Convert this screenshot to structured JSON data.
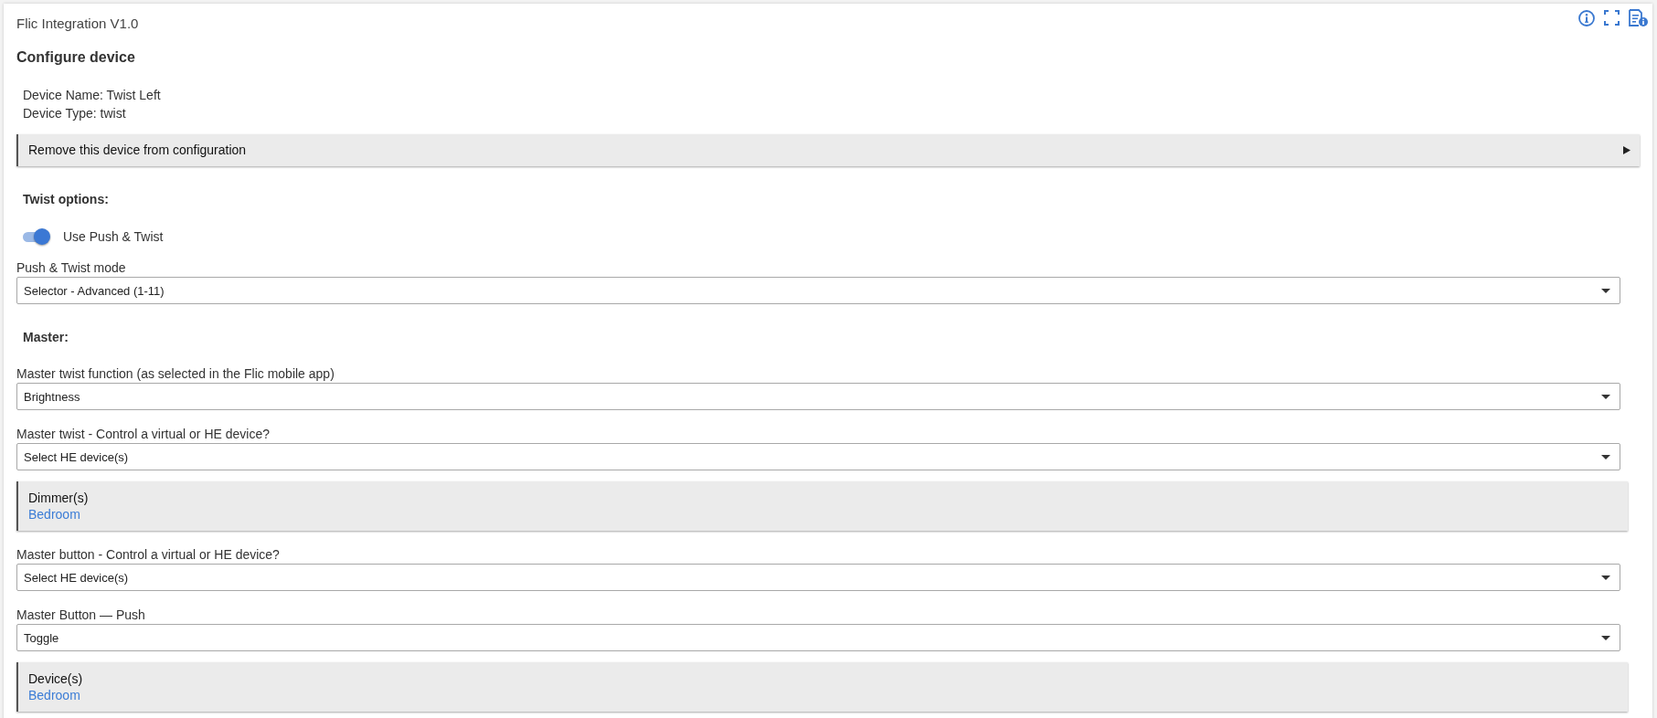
{
  "header": {
    "title": "Flic Integration V1.0"
  },
  "page": {
    "heading": "Configure device",
    "info": [
      "Device Name: Twist Left",
      "Device Type: twist"
    ]
  },
  "items": [
    {
      "kind": "collapsible",
      "label": "Remove this device from configuration",
      "expanded": false
    },
    {
      "kind": "heading",
      "text": "Twist options:"
    },
    {
      "kind": "toggle",
      "label": "Use Push & Twist",
      "on": true
    },
    {
      "kind": "select",
      "label": "Push & Twist mode",
      "value": "Selector - Advanced (1-11)"
    },
    {
      "kind": "heading",
      "text": "Master:"
    },
    {
      "kind": "select",
      "label": "Master twist function (as selected in the Flic mobile app)",
      "value": "Brightness"
    },
    {
      "kind": "select",
      "label": "Master twist - Control a virtual or HE device?",
      "value": "Select HE device(s)"
    },
    {
      "kind": "device_panel",
      "title": "Dimmer(s)",
      "value": "Bedroom"
    },
    {
      "kind": "select",
      "label": "Master button - Control a virtual or HE device?",
      "value": "Select HE device(s)"
    },
    {
      "kind": "select",
      "label": "Master Button — Push",
      "value": "Toggle"
    },
    {
      "kind": "device_panel",
      "title": "Device(s)",
      "value": "Bedroom"
    }
  ]
}
